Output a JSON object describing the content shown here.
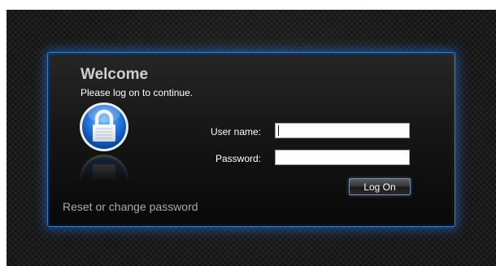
{
  "login": {
    "title": "Welcome",
    "subtitle": "Please log on to continue.",
    "username_label": "User name:",
    "username_value": "",
    "password_label": "Password:",
    "password_value": "",
    "submit_label": "Log On",
    "reset_link": "Reset or change password"
  },
  "icons": {
    "lock": "padlock-icon"
  },
  "colors": {
    "accent_glow": "#2f7fd6",
    "panel_background": "#111111",
    "page_background": "#141414",
    "title_text": "#cfcfcf",
    "link_text": "#a9a9a9"
  }
}
